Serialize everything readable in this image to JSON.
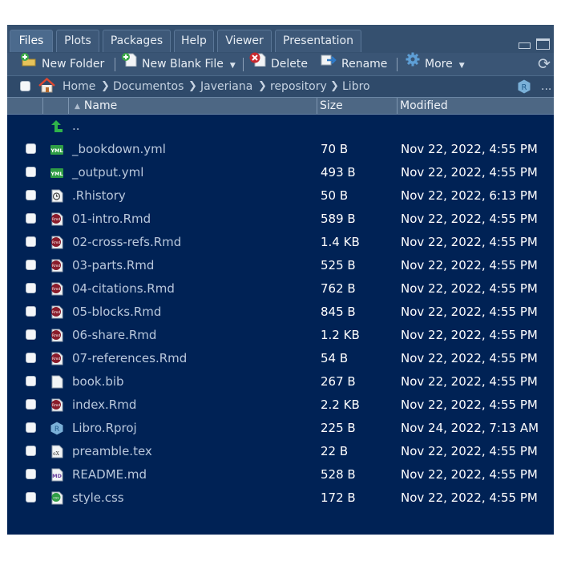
{
  "tabs": [
    {
      "label": "Files",
      "active": true
    },
    {
      "label": "Plots"
    },
    {
      "label": "Packages"
    },
    {
      "label": "Help"
    },
    {
      "label": "Viewer"
    },
    {
      "label": "Presentation"
    }
  ],
  "toolbar": {
    "new_folder": "New Folder",
    "new_blank_file": "New Blank File",
    "delete": "Delete",
    "rename": "Rename",
    "more": "More"
  },
  "breadcrumb": [
    "Home",
    "Documentos",
    "Javeriana",
    "repository",
    "Libro"
  ],
  "breadcrumb_overflow": "...",
  "columns": {
    "name": "Name",
    "size": "Size",
    "modified": "Modified"
  },
  "parent_dir": "..",
  "files": [
    {
      "name": "_bookdown.yml",
      "size": "70 B",
      "modified": "Nov 22, 2022, 4:55 PM",
      "icon": "yml-file-icon"
    },
    {
      "name": "_output.yml",
      "size": "493 B",
      "modified": "Nov 22, 2022, 4:55 PM",
      "icon": "yml-file-icon"
    },
    {
      "name": ".Rhistory",
      "size": "50 B",
      "modified": "Nov 22, 2022, 6:13 PM",
      "icon": "history-file-icon"
    },
    {
      "name": "01-intro.Rmd",
      "size": "589 B",
      "modified": "Nov 22, 2022, 4:55 PM",
      "icon": "rmd-file-icon"
    },
    {
      "name": "02-cross-refs.Rmd",
      "size": "1.4 KB",
      "modified": "Nov 22, 2022, 4:55 PM",
      "icon": "rmd-file-icon"
    },
    {
      "name": "03-parts.Rmd",
      "size": "525 B",
      "modified": "Nov 22, 2022, 4:55 PM",
      "icon": "rmd-file-icon"
    },
    {
      "name": "04-citations.Rmd",
      "size": "762 B",
      "modified": "Nov 22, 2022, 4:55 PM",
      "icon": "rmd-file-icon"
    },
    {
      "name": "05-blocks.Rmd",
      "size": "845 B",
      "modified": "Nov 22, 2022, 4:55 PM",
      "icon": "rmd-file-icon"
    },
    {
      "name": "06-share.Rmd",
      "size": "1.2 KB",
      "modified": "Nov 22, 2022, 4:55 PM",
      "icon": "rmd-file-icon"
    },
    {
      "name": "07-references.Rmd",
      "size": "54 B",
      "modified": "Nov 22, 2022, 4:55 PM",
      "icon": "rmd-file-icon"
    },
    {
      "name": "book.bib",
      "size": "267 B",
      "modified": "Nov 22, 2022, 4:55 PM",
      "icon": "blank-file-icon"
    },
    {
      "name": "index.Rmd",
      "size": "2.2 KB",
      "modified": "Nov 22, 2022, 4:55 PM",
      "icon": "rmd-file-icon"
    },
    {
      "name": "Libro.Rproj",
      "size": "225 B",
      "modified": "Nov 24, 2022, 7:13 AM",
      "icon": "rproj-file-icon"
    },
    {
      "name": "preamble.tex",
      "size": "22 B",
      "modified": "Nov 22, 2022, 4:55 PM",
      "icon": "tex-file-icon"
    },
    {
      "name": "README.md",
      "size": "528 B",
      "modified": "Nov 22, 2022, 4:55 PM",
      "icon": "md-file-icon"
    },
    {
      "name": "style.css",
      "size": "172 B",
      "modified": "Nov 22, 2022, 4:55 PM",
      "icon": "css-file-icon"
    }
  ],
  "colors": {
    "panel_bg": "#002255",
    "tab_bar_bg": "#35506f",
    "toolbar_bg": "#3a5575",
    "header_bg": "#4d6784",
    "filename_text": "#b9c8dc",
    "meta_text": "#ffffff"
  }
}
